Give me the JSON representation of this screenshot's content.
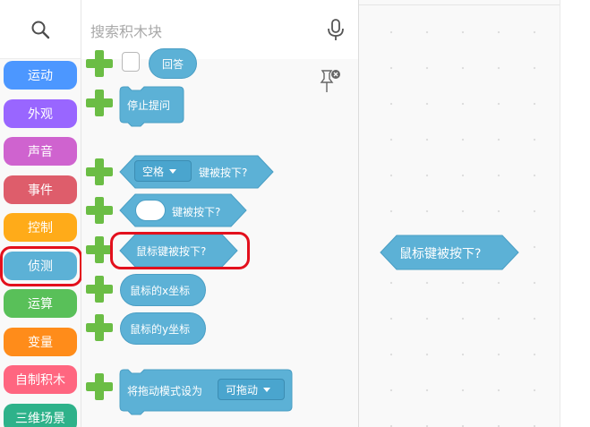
{
  "search": {
    "placeholder": "搜索积木块"
  },
  "categories": [
    {
      "label": "运动",
      "color": "#4c97ff"
    },
    {
      "label": "外观",
      "color": "#9966ff"
    },
    {
      "label": "声音",
      "color": "#cf63cf"
    },
    {
      "label": "事件",
      "color": "#de5d6b"
    },
    {
      "label": "控制",
      "color": "#ffab19"
    },
    {
      "label": "侦测",
      "color": "#5cb1d6"
    },
    {
      "label": "运算",
      "color": "#59c059"
    },
    {
      "label": "变量",
      "color": "#ff8c1a"
    },
    {
      "label": "自制积木",
      "color": "#ff6680"
    },
    {
      "label": "三维场景",
      "color": "#2eb28a"
    }
  ],
  "selected_category": "侦测",
  "blocks": {
    "answer": "回答",
    "stop_asking": "停止提问",
    "key_pressed_option": "空格",
    "key_pressed_label": "键被按下?",
    "key_pressed_empty_label": "键被按下?",
    "mouse_down": "鼠标键被按下?",
    "mouse_x": "鼠标的x坐标",
    "mouse_y": "鼠标的y坐标",
    "drag_mode_label": "将拖动模式设为",
    "drag_mode_option": "可拖动"
  },
  "workspace": {
    "block": "鼠标键被按下?"
  },
  "colors": {
    "sensing": "#5cb1d6",
    "sensing_dark": "#4a9ec4",
    "highlight": "#e3101d",
    "plus": "#6bbd45"
  }
}
